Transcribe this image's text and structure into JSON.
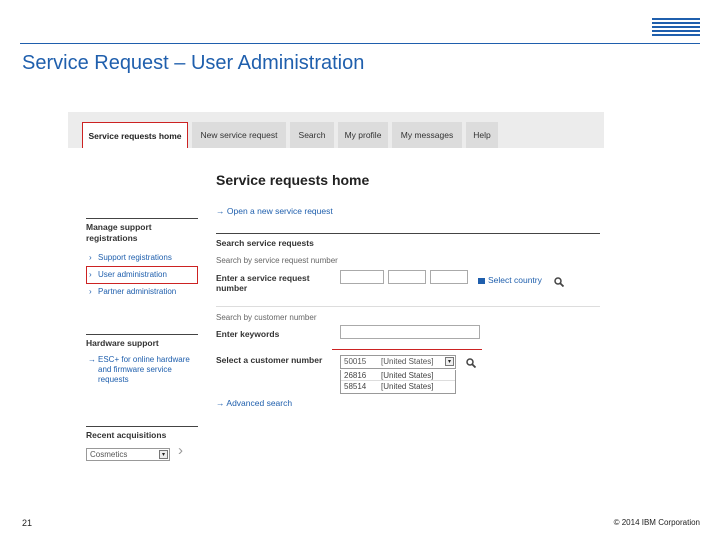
{
  "slide": {
    "title": "Service Request – User Administration",
    "page_number": "21",
    "copyright": "© 2014 IBM Corporation",
    "logo_text": "IBM",
    "accent_color": "#1f5fad"
  },
  "tabs": [
    {
      "label": "Service requests home",
      "active": true
    },
    {
      "label": "New service request",
      "active": false
    },
    {
      "label": "Search",
      "active": false
    },
    {
      "label": "My profile",
      "active": false
    },
    {
      "label": "My messages",
      "active": false
    },
    {
      "label": "Help",
      "active": false
    }
  ],
  "page_heading": "Service requests home",
  "sidebar": {
    "manage_title": "Manage support registrations",
    "manage_links": [
      "Support registrations",
      "User administration",
      "Partner administration"
    ],
    "hardware_title": "Hardware support",
    "hardware_link": "ESC+ for online hardware and firmware service requests",
    "recent_title": "Recent acquisitions",
    "recent_select": "Cosmetics"
  },
  "main": {
    "open_new_link": "Open a new service request",
    "search_heading": "Search service requests",
    "search_by_number": "Search by service request number",
    "enter_number_label": "Enter a service request number",
    "select_country_link": "Select country",
    "search_by_customer": "Search by customer number",
    "enter_keywords_label": "Enter keywords",
    "select_customer_label": "Select a customer number",
    "customer_select": {
      "number": "50015",
      "country": "[United States]"
    },
    "customer_options": [
      {
        "number": "26816",
        "country": "[United States]"
      },
      {
        "number": "58514",
        "country": "[United States]"
      }
    ],
    "advanced_search_link": "Advanced search"
  }
}
